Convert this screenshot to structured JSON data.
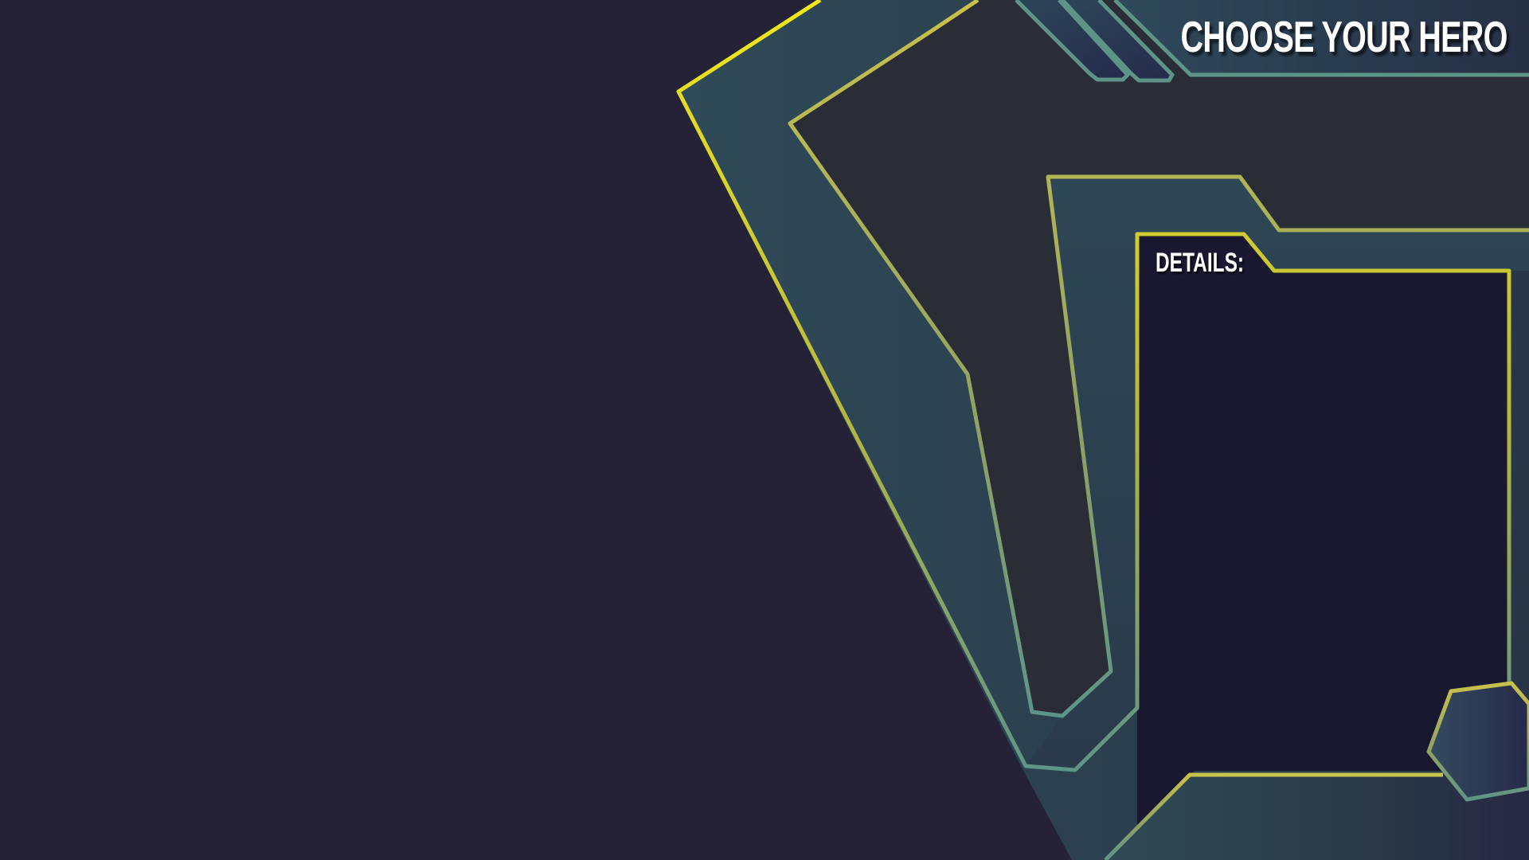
{
  "screen": {
    "title": "CHOOSE YOUR HERO",
    "details_label": "DETAILS:"
  },
  "theme": {
    "background": "#252238",
    "panel_dark": "#1a1830",
    "teal_fill": "#314c5a",
    "accent_yellow": "#f2e81a",
    "accent_teal": "#5e9488",
    "text": "#ffffff"
  }
}
